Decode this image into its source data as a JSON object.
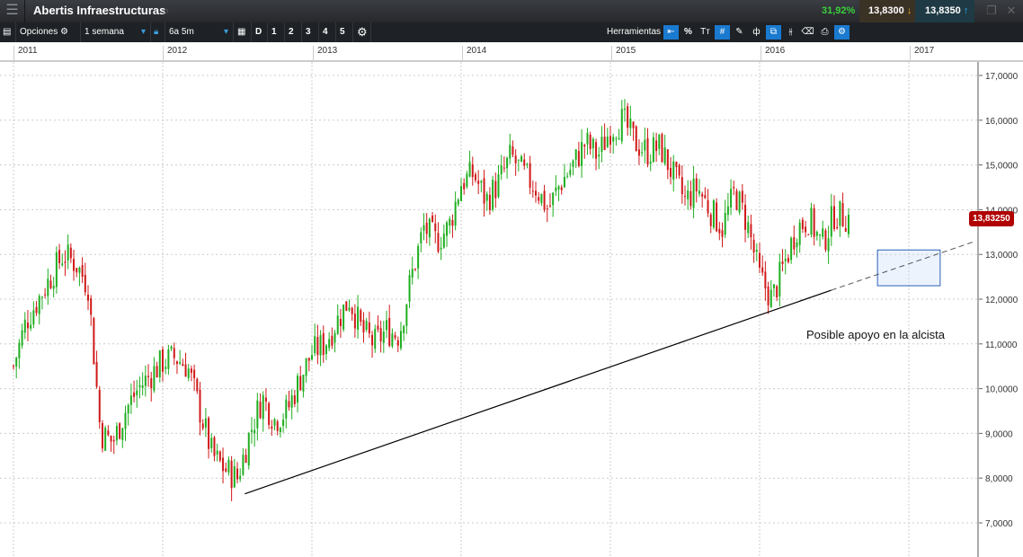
{
  "header": {
    "title": "Abertis Infraestructuras",
    "change_pct": "31,92%",
    "sell_price": "13,8300",
    "buy_price": "13,8350"
  },
  "toolbar": {
    "options_label": "Opciones",
    "interval": "1 semana",
    "range": "6a 5m",
    "periods": [
      "D",
      "1",
      "2",
      "3",
      "4",
      "5"
    ],
    "tools_label": "Herramientas",
    "tool_pct": "%",
    "tool_text": "Tт"
  },
  "date_axis": [
    "2011",
    "2012",
    "2013",
    "2014",
    "2015",
    "2016",
    "2017"
  ],
  "current_price_label": "13,83250",
  "annotation": "Posible apoyo en la alcista",
  "chart_data": {
    "type": "candlestick",
    "title": "Abertis Infraestructuras",
    "interval": "weekly",
    "ylim": [
      6.6,
      17.3
    ],
    "xlim": [
      2010.98,
      2017.45
    ],
    "y_ticks": [
      "7,0000",
      "8,0000",
      "9,0000",
      "10,0000",
      "11,0000",
      "12,0000",
      "13,0000",
      "14,0000",
      "15,0000",
      "16,0000",
      "17,0000"
    ],
    "y_tick_values": [
      7,
      8,
      9,
      10,
      11,
      12,
      13,
      14,
      15,
      16,
      17
    ],
    "monthly_close_approx_start": "2011-01",
    "monthly_close_approx": [
      10.5,
      11.5,
      12.0,
      12.5,
      13.0,
      12.8,
      12.3,
      9.0,
      8.8,
      9.5,
      10.0,
      10.3,
      10.6,
      10.7,
      10.5,
      9.5,
      8.5,
      8.2,
      8.0,
      9.0,
      9.8,
      9.3,
      9.5,
      10.2,
      10.8,
      11.0,
      11.5,
      12.0,
      11.3,
      11.0,
      11.3,
      11.2,
      12.5,
      13.6,
      13.3,
      13.6,
      14.6,
      14.8,
      14.2,
      14.6,
      15.2,
      14.8,
      14.5,
      14.0,
      14.6,
      15.0,
      15.5,
      15.2,
      15.8,
      16.0,
      15.5,
      15.3,
      15.4,
      14.8,
      14.2,
      14.5,
      14.0,
      13.6,
      14.4,
      13.7,
      12.5,
      12.0,
      12.8,
      13.6,
      13.8,
      13.2,
      13.9,
      13.83
    ],
    "last_price": 13.8325,
    "trendline": {
      "start": [
        2012.55,
        7.65
      ],
      "end": [
        2016.48,
        12.2
      ],
      "projection_end": [
        2017.45,
        13.3
      ]
    },
    "support_zone": {
      "x": [
        2016.79,
        2017.21
      ],
      "y": [
        12.3,
        13.1
      ]
    },
    "colors": {
      "up": "#1fae1f",
      "down": "#d01818"
    }
  }
}
